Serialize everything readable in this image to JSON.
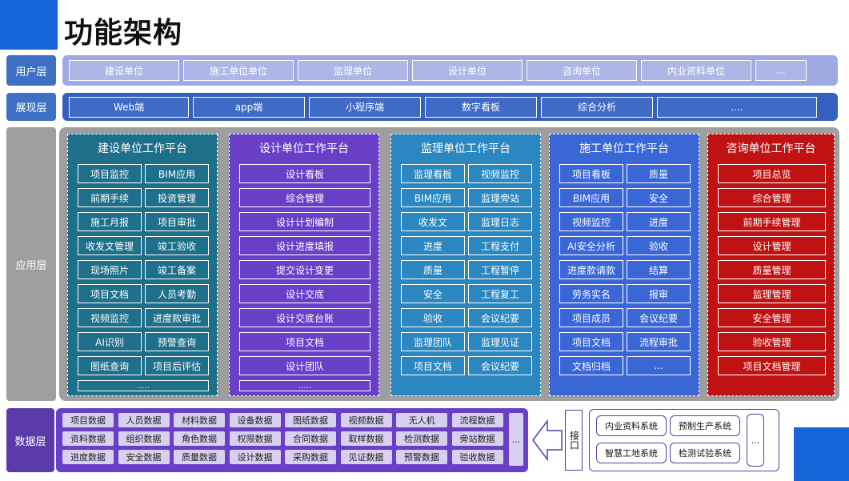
{
  "title": "功能架构",
  "layers": {
    "user": "用户层",
    "display": "展现层",
    "application": "应用层",
    "data": "数据层"
  },
  "user_layer": [
    "建设单位",
    "施工单位单位",
    "监理单位",
    "设计单位",
    "咨询单位",
    "内业资料单位",
    "..."
  ],
  "display_layer": [
    "Web端",
    "app端",
    "小程序端",
    "数字看板",
    "综合分析",
    "...."
  ],
  "platforms": [
    {
      "title": "建设单位工作平台",
      "color": "#1e6f8a",
      "columns": 2,
      "items": [
        "项目监控",
        "BIM应用",
        "前期手续",
        "投资管理",
        "施工月报",
        "项目审批",
        "收发文管理",
        "竣工验收",
        "现场照片",
        "竣工备案",
        "项目文档",
        "人员考勤",
        "视频监控",
        "进度款审批",
        "AI识别",
        "预警查询",
        "图纸查询",
        "项目后评估"
      ],
      "more": "....."
    },
    {
      "title": "设计单位工作平台",
      "color": "#6a3fc8",
      "columns": 1,
      "items": [
        "设计看板",
        "综合管理",
        "设计计划编制",
        "设计进度填报",
        "提交设计变更",
        "设计交底",
        "设计交底台账",
        "项目文档",
        "设计团队"
      ],
      "more": "....."
    },
    {
      "title": "监理单位工作平台",
      "color": "#2a87c0",
      "columns": 2,
      "items": [
        "监理看板",
        "视频监控",
        "BIM应用",
        "监理旁站",
        "收发文",
        "监理日志",
        "进度",
        "工程支付",
        "质量",
        "工程暂停",
        "安全",
        "工程复工",
        "验收",
        "会议纪要",
        "监理团队",
        "监理见证",
        "项目文档",
        "会议纪要"
      ]
    },
    {
      "title": "施工单位工作平台",
      "color": "#3a66d6",
      "columns": 2,
      "items": [
        "项目看板",
        "质量",
        "BIM应用",
        "安全",
        "视频监控",
        "进度",
        "AI安全分析",
        "验收",
        "进度款请款",
        "结算",
        "劳务实名",
        "报审",
        "项目成员",
        "会议纪要",
        "项目文档",
        "流程审批",
        "文档归档",
        "..."
      ]
    },
    {
      "title": "咨询单位工作平台",
      "color": "#c01212",
      "columns": 1,
      "items": [
        "项目总览",
        "综合管理",
        "前期手续管理",
        "设计管理",
        "质量管理",
        "监理管理",
        "安全管理",
        "验收管理",
        "项目文档管理"
      ]
    }
  ],
  "data_layer": {
    "rows": [
      [
        "项目数据",
        "人员数据",
        "材料数据",
        "设备数据",
        "图纸数据",
        "视频数据",
        "无人机",
        "流程数据"
      ],
      [
        "资料数据",
        "组织数据",
        "角色数据",
        "权限数据",
        "合同数据",
        "取样数据",
        "检测数据",
        "旁站数据"
      ],
      [
        "进度数据",
        "安全数据",
        "质量数据",
        "设计数据",
        "采购数据",
        "见证数据",
        "预警数据",
        "验收数据"
      ]
    ],
    "more": "..."
  },
  "interface_label": "接口",
  "systems": [
    "内业资料系统",
    "预制生产系统",
    "智慧工地系统",
    "检测试验系统"
  ],
  "systems_more": "...",
  "colors": {
    "accent": "#1565d8",
    "layer_label": "#3d6fc2",
    "data_row": "#6a3fc8"
  }
}
